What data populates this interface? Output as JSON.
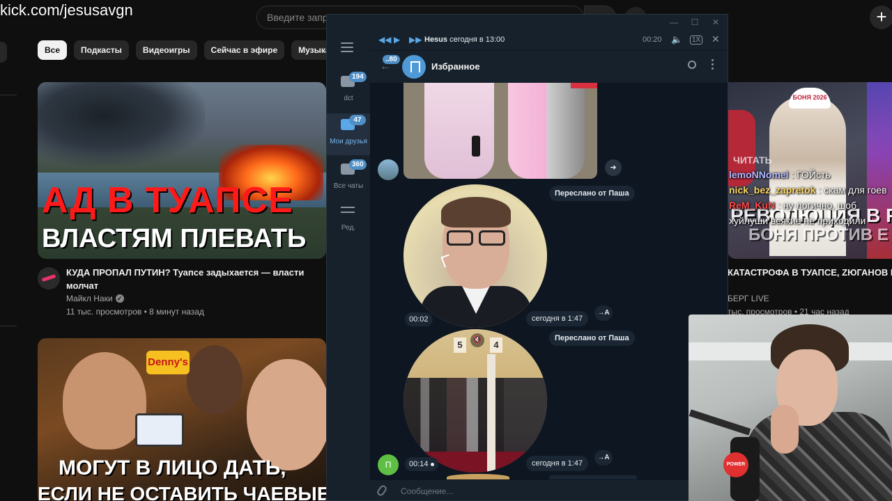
{
  "overlay_url": "kick.com/jesusavgn",
  "youtube": {
    "search_placeholder": "Введите запрос",
    "chips": [
      "Все",
      "Подкасты",
      "Видеоигры",
      "Сейчас в эфире",
      "Музыка"
    ],
    "video1": {
      "thumb_line1": "АД В ТУАПСЕ",
      "thumb_line2": "ВЛАСТЯМ ПЛЕВАТЬ",
      "title": "КУДА ПРОПАЛ ПУТИН? Туапсе задыхается — власти молчат",
      "channel": "Майкл Наки",
      "stats": "11 тыс. просмотров • 8 минут назад"
    },
    "video2": {
      "sign": "Denny's",
      "thumb_line1": "МОГУТ В ЛИЦО ДАТЬ,",
      "thumb_line2": "ЕСЛИ НЕ ОСТАВИТЬ ЧАЕВЫЕ?"
    },
    "video3": {
      "cap_text": "БОНЯ 2026",
      "thumb_big1": "РЕВОЛЮЦИЯ В Р",
      "thumb_big2": "БОНЯ ПРОТИВ Е",
      "thumb_ghost": "ЧИТАТЬ",
      "title": "КАТАСТРОФА В ТУАПСЕ, ZЮГАНОВ ПРО РЕВОЛЮЦИЕЙ, А СОБОЛЕВ - ЛИЦОМ I М",
      "channel": "БЕРГ LIVE",
      "stats": "тыс. просмотров • 21 час назад"
    }
  },
  "stream_chat": [
    {
      "user": "lemoNNomel",
      "text": ": ГОЙсть"
    },
    {
      "user": "nick_bez_zapretok",
      "text": ": скам для гоев"
    },
    {
      "user": "ReM_KuN",
      "text": ": ну логично, шоб хуйлуши всякие не приходили"
    }
  ],
  "telegram": {
    "folders": [
      {
        "label": "dct",
        "badge": "194"
      },
      {
        "label": "Мои друзья",
        "badge": "47"
      },
      {
        "label": "Все чаты",
        "badge": "360"
      },
      {
        "label": "Ред.",
        "badge": ""
      }
    ],
    "player": {
      "title_bold": "Hesus",
      "title_rest": " сегодня в 13:00",
      "time": "00:20",
      "speed": "1X"
    },
    "header": {
      "back_badge": "..80",
      "chat_title": "Избранное"
    },
    "messages": [
      {
        "forwarded_from": "Переслано от Паша",
        "duration": "00:02",
        "time": "сегодня в 1:47",
        "transcribe": "→A"
      },
      {
        "forwarded_from": "Переслано от Паша",
        "duration": "00:14",
        "time": "сегодня в 1:47",
        "transcribe": "→A",
        "avatar_letter": "П"
      }
    ],
    "input_placeholder": "Сообщение..."
  },
  "webcam": {
    "mic_badge": "POWER"
  },
  "colors": {
    "accent": "#5aa8e8",
    "badge": "#4f8fc6",
    "bg": "#0e1621"
  }
}
